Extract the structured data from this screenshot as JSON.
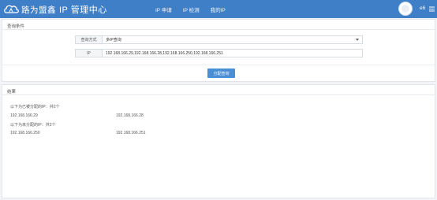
{
  "header": {
    "brand": "路为盟鑫",
    "app_title": "IP 管理中心",
    "nav": [
      "IP 申请",
      "IP 检测",
      "我的IP"
    ],
    "username": "e6",
    "accent": "#3f7fc7"
  },
  "query_panel": {
    "title": "查询条件",
    "method_label": "查询方式",
    "method_value": "多IP查询",
    "ip_label": "IP",
    "ip_value": "192.168.166.29,192.168.166.28,192.168.166.250,192.168.166.251",
    "submit_label": "分配查询"
  },
  "result_panel": {
    "title": "结果",
    "assigned_title": "以下为已被分配的IP：共2个",
    "assigned_ips": [
      "192.168.166.29",
      "192.168.166.28"
    ],
    "unassigned_title": "以下为未分配的IP：共2个",
    "unassigned_ips": [
      "192.168.166.250",
      "192.168.166.251"
    ]
  }
}
